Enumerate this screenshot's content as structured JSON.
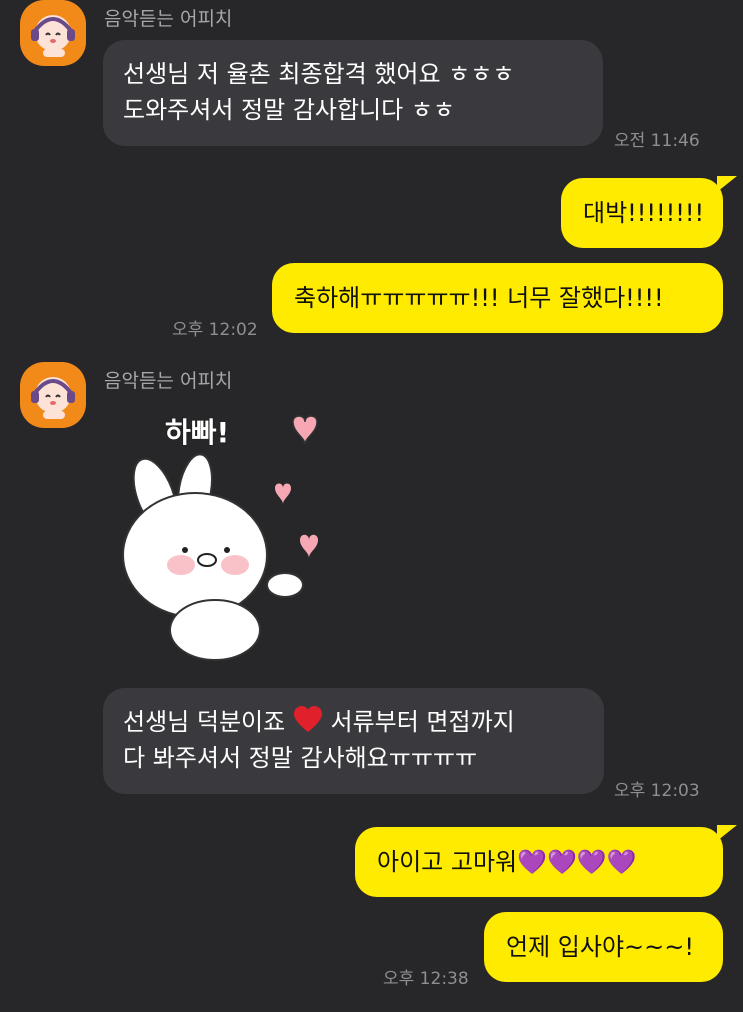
{
  "chat": {
    "sender_name": "음악듣는 어피치",
    "msg1_line1": "선생님 저 율촌 최종합격 했어요 ㅎㅎㅎ",
    "msg1_line2": "도와주셔서 정말 감사합니다 ㅎㅎ",
    "time1": "오전 11:46",
    "msg2": "대박!!!!!!!!",
    "msg3": "축하해ㅠㅠㅠㅠㅠ!!! 너무 잘했다!!!!",
    "time2": "오후 12:02",
    "sticker_text": "하빠!",
    "msg4_line1_a": "선생님 덕분이죠",
    "msg4_line1_b": "서류부터 면접까지",
    "msg4_line2": "다 봐주셔서 정말 감사해요ㅠㅠㅠㅠ",
    "time3": "오후 12:03",
    "msg5": "아이고 고마워💜💜💜💜",
    "msg6": "언제 입사야~~~!",
    "time4": "오후 12:38"
  },
  "colors": {
    "background": "#27272a",
    "incoming_bubble": "#3a3a3e",
    "outgoing_bubble": "#ffeb00",
    "avatar": "#f28a1a"
  },
  "icons": {
    "avatar": "apeach-with-headphones",
    "sticker": "white-bunny-with-hearts",
    "emoji_heart": "red-heart"
  }
}
